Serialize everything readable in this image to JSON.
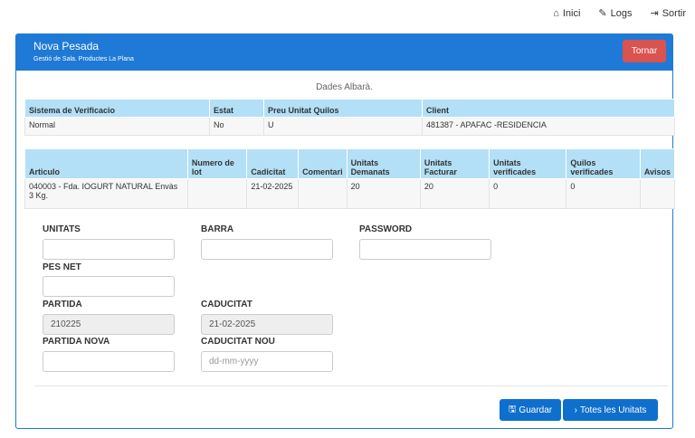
{
  "nav": {
    "inici": "Inici",
    "logs": "Logs",
    "sortir": "Sortir"
  },
  "header": {
    "title": "Nova Pesada",
    "subtitle": "Gestió de Sala. Productes La Plana",
    "tornar": "Tornar"
  },
  "caption": "Dades Albarà.",
  "albara": {
    "headers": [
      "Sistema de Verificacio",
      "Estat",
      "Preu Unitat Quilos",
      "Client"
    ],
    "row": [
      "Normal",
      "No",
      "U",
      "481387 - APAFAC -RESIDENCIA"
    ]
  },
  "articles": {
    "headers": [
      "Articulo",
      "Numero de lot",
      "Cadicitat",
      "Comentari",
      "Unitats Demanats",
      "Unitats Facturar",
      "Unitats verificades",
      "Quilos verificades",
      "Avisos"
    ],
    "row": [
      "040003 - Fda. IOGURT NATURAL Envàs 3 Kg.",
      "",
      "21-02-2025",
      "",
      "20",
      "20",
      "0",
      "0",
      ""
    ]
  },
  "form": {
    "unitats": "UNITATS",
    "barra": "BARRA",
    "password": "PASSWORD",
    "pes_net": "PES NET",
    "partida": "PARTIDA",
    "partida_value": "210225",
    "caducitat": "CADUCITAT",
    "caducitat_value": "21-02-2025",
    "partida_nova": "PARTIDA NOVA",
    "caducitat_nou": "CADUCITAT NOU",
    "caducitat_nou_placeholder": "dd-mm-yyyy"
  },
  "buttons": {
    "guardar": "Guardar",
    "totes": "Totes les Unitats"
  }
}
